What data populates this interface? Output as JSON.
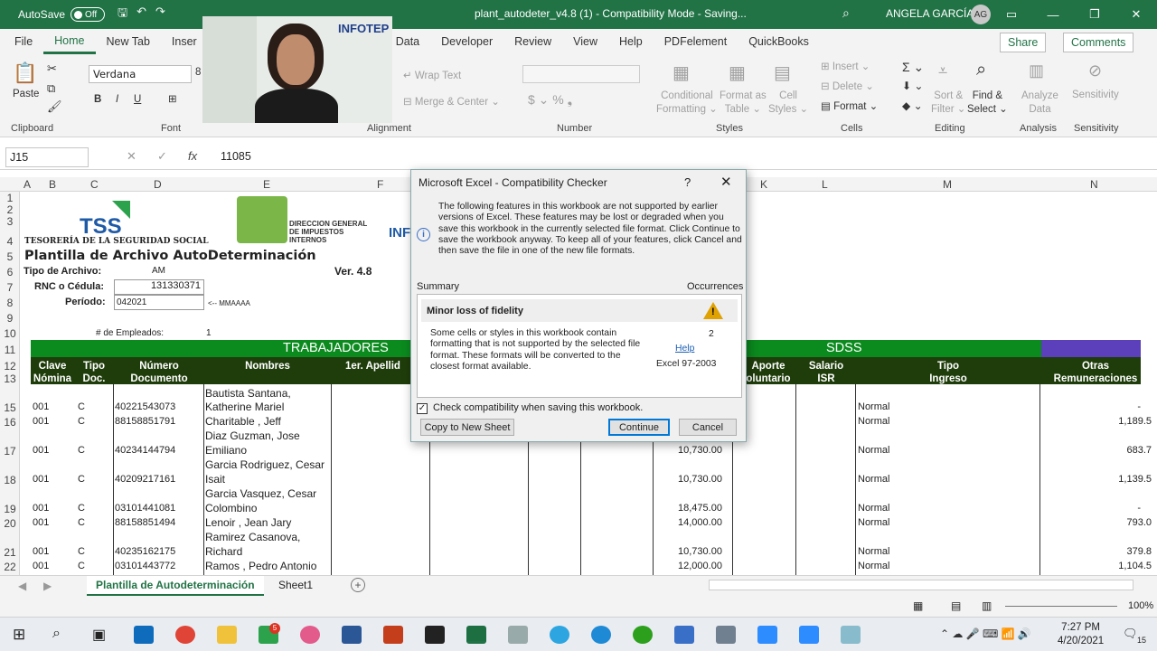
{
  "titlebar": {
    "autosave": "AutoSave",
    "autosave_state": "Off",
    "doc_title": "plant_autodeter_v4.8 (1)  -  Compatibility Mode  -  Saving...",
    "user": "ANGELA GARCÍA",
    "initials": "AG"
  },
  "menu": {
    "file": "File",
    "home": "Home",
    "newtab": "New Tab",
    "insert": "Inser",
    "data": "Data",
    "developer": "Developer",
    "review": "Review",
    "view": "View",
    "help": "Help",
    "pdf": "PDFelement",
    "qb": "QuickBooks",
    "share": "Share",
    "comments": "Comments"
  },
  "ribbon": {
    "paste": "Paste",
    "clipboard": "Clipboard",
    "font_name": "Verdana",
    "font_size": "8",
    "font": "Font",
    "wrap": "Wrap Text",
    "merge": "Merge & Center",
    "alignment": "Alignment",
    "number": "Number",
    "cond1": "Conditional",
    "cond2": "Formatting",
    "fat1": "Format as",
    "fat2": "Table",
    "cs1": "Cell",
    "cs2": "Styles",
    "styles": "Styles",
    "insert": "Insert",
    "delete": "Delete",
    "format": "Format",
    "cells": "Cells",
    "sf1": "Sort &",
    "sf2": "Filter",
    "fs1": "Find &",
    "fs2": "Select",
    "editing": "Editing",
    "ad1": "Analyze",
    "ad2": "Data",
    "analysis": "Analysis",
    "sensitivity_btn": "Sensitivity",
    "sensitivity": "Sensitivity"
  },
  "formula": {
    "cell_ref": "J15",
    "value": "11085",
    "fx": "fx"
  },
  "columns": [
    "A",
    "B",
    "C",
    "D",
    "E",
    "F",
    "K",
    "L",
    "M",
    "N"
  ],
  "rows": [
    "1",
    "2",
    "3",
    "4",
    "5",
    "6",
    "7",
    "8",
    "9",
    "10",
    "11",
    "12",
    "13",
    "15",
    "16",
    "17",
    "18",
    "19",
    "20",
    "21",
    "22"
  ],
  "sheet": {
    "tss_logo": "TSS",
    "tesoreria": "TESORERÍA DE LA SEGURIDAD SOCIAL",
    "dgii1": "DIRECCION GENERAL",
    "dgii2": "DE IMPUESTOS",
    "dgii3": "INTERNOS",
    "infotep_cut": "INF",
    "plantilla": "Plantilla de Archivo AutoDeterminación",
    "version": "Ver. 4.8",
    "tipo_label": "Tipo de Archivo:",
    "tipo_value": "AM",
    "rnc_label": "RNC o Cédula:",
    "rnc_value": "131330371",
    "periodo_label": "Período:",
    "periodo_value": "042021",
    "periodo_hint": "<-- MMAAAA",
    "empleados_label": "# de Empleados:",
    "empleados_value": "1",
    "trabajadores": "TRABAJADORES",
    "sdss": "SDSS",
    "headers": {
      "clave1": "Clave",
      "clave2": "Nómina",
      "tipo1": "Tipo",
      "tipo2": "Doc.",
      "num1": "Número",
      "num2": "Documento",
      "nombres": "Nombres",
      "apellido": "1er. Apellid",
      "aporte1": "Aporte",
      "aporte2": "oluntario",
      "salario1": "Salario",
      "salario2": "ISR",
      "ingreso1": "Tipo",
      "ingreso2": "Ingreso",
      "otras1": "Otras",
      "otras2": "Remuneraciones"
    },
    "data": [
      {
        "clave": "001",
        "tipo": "C",
        "num": "40221543073",
        "n1": "Bautista Santana,",
        "n2": "Katherine Mariel",
        "sal": "",
        "ing": "Normal",
        "otras": "-"
      },
      {
        "clave": "001",
        "tipo": "C",
        "num": "88158851791",
        "n1": "Charitable , Jeff",
        "n2": "",
        "sal": "",
        "ing": "Normal",
        "otras": "1,189.5"
      },
      {
        "clave": "001",
        "tipo": "C",
        "num": "40234144794",
        "n1": "Diaz Guzman, Jose",
        "n2": "Emiliano",
        "sal": "10,730.00",
        "ing": "Normal",
        "otras": "683.7"
      },
      {
        "clave": "001",
        "tipo": "C",
        "num": "40209217161",
        "n1": "Garcia Rodriguez, Cesar",
        "n2": "Isait",
        "sal": "10,730.00",
        "ing": "Normal",
        "otras": "1,139.5"
      },
      {
        "clave": "001",
        "tipo": "C",
        "num": "03101441081",
        "n1": "Garcia Vasquez, Cesar",
        "n2": "Colombino",
        "sal": "18,475.00",
        "ing": "Normal",
        "otras": "-"
      },
      {
        "clave": "001",
        "tipo": "C",
        "num": "88158851494",
        "n1": "Lenoir , Jean Jary",
        "n2": "",
        "sal": "14,000.00",
        "ing": "Normal",
        "otras": "793.0"
      },
      {
        "clave": "001",
        "tipo": "C",
        "num": "40235162175",
        "n1": "Ramirez Casanova,",
        "n2": "Richard",
        "sal": "10,730.00",
        "ing": "Normal",
        "otras": "379.8"
      },
      {
        "clave": "001",
        "tipo": "C",
        "num": "03101443772",
        "n1": "Ramos , Pedro Antonio",
        "n2": "",
        "sal": "12,000.00",
        "ing": "Normal",
        "otras": "1,104.5"
      }
    ]
  },
  "webcam": {
    "brand": "INFOTEP"
  },
  "dialog": {
    "title": "Microsoft Excel - Compatibility Checker",
    "help_q": "?",
    "close": "✕",
    "message": "The following features in this workbook are not supported by earlier versions of Excel. These features may be lost or degraded when you save this workbook in the currently selected file format. Click Continue to save the workbook anyway. To keep all of your features, click Cancel and then save the file in one of the new file formats.",
    "summary": "Summary",
    "occurrences": "Occurrences",
    "issue_title": "Minor loss of fidelity",
    "issue_desc": "Some cells or styles in this workbook contain formatting that is not supported by the selected file format. These formats will be converted to the closest format available.",
    "issue_count": "2",
    "help_link": "Help",
    "issue_version": "Excel 97-2003",
    "check_label": "Check compatibility when saving this workbook.",
    "copy_btn": "Copy to New Sheet",
    "continue_btn": "Continue",
    "cancel_btn": "Cancel"
  },
  "tabs": {
    "active": "Plantilla de Autodeterminación",
    "sheet1": "Sheet1",
    "add": "+"
  },
  "status": {
    "zoom": "100%"
  },
  "taskbar": {
    "time": "7:27 PM",
    "date": "4/20/2021",
    "badge": "5",
    "notif": "15"
  }
}
